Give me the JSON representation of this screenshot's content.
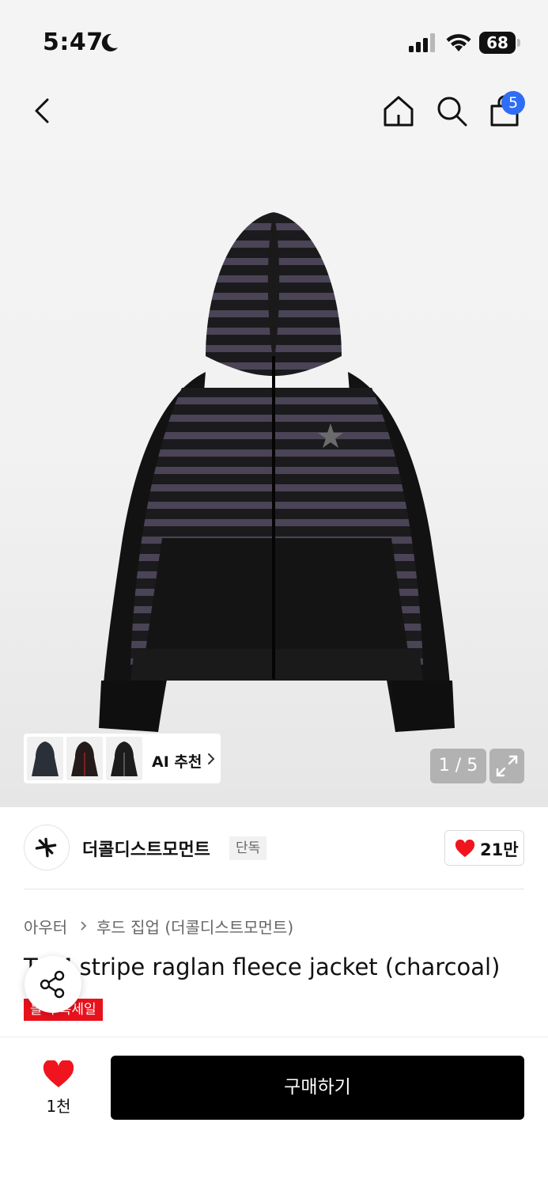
{
  "status_bar": {
    "time": "5:47",
    "battery": "68"
  },
  "nav": {
    "cart_count": "5"
  },
  "gallery": {
    "ai_label": "AI 추천",
    "pager": "1 / 5"
  },
  "brand": {
    "name": "더콜디스트모먼트",
    "tag": "단독",
    "likes": "21만"
  },
  "breadcrumb": {
    "level1": "아우터",
    "level2": "후드 집업 (더콜디스트모먼트)"
  },
  "product": {
    "title": "TCM stripe raglan fleece jacket (charcoal)",
    "sale_badge": "블랙 특세일"
  },
  "bottom_bar": {
    "likes": "1천",
    "buy_label": "구매하기"
  },
  "colors": {
    "accent_blue": "#2f6df5",
    "sale_red": "#e8121c",
    "heart_red": "#f0141e",
    "buy_button": "#000000"
  }
}
